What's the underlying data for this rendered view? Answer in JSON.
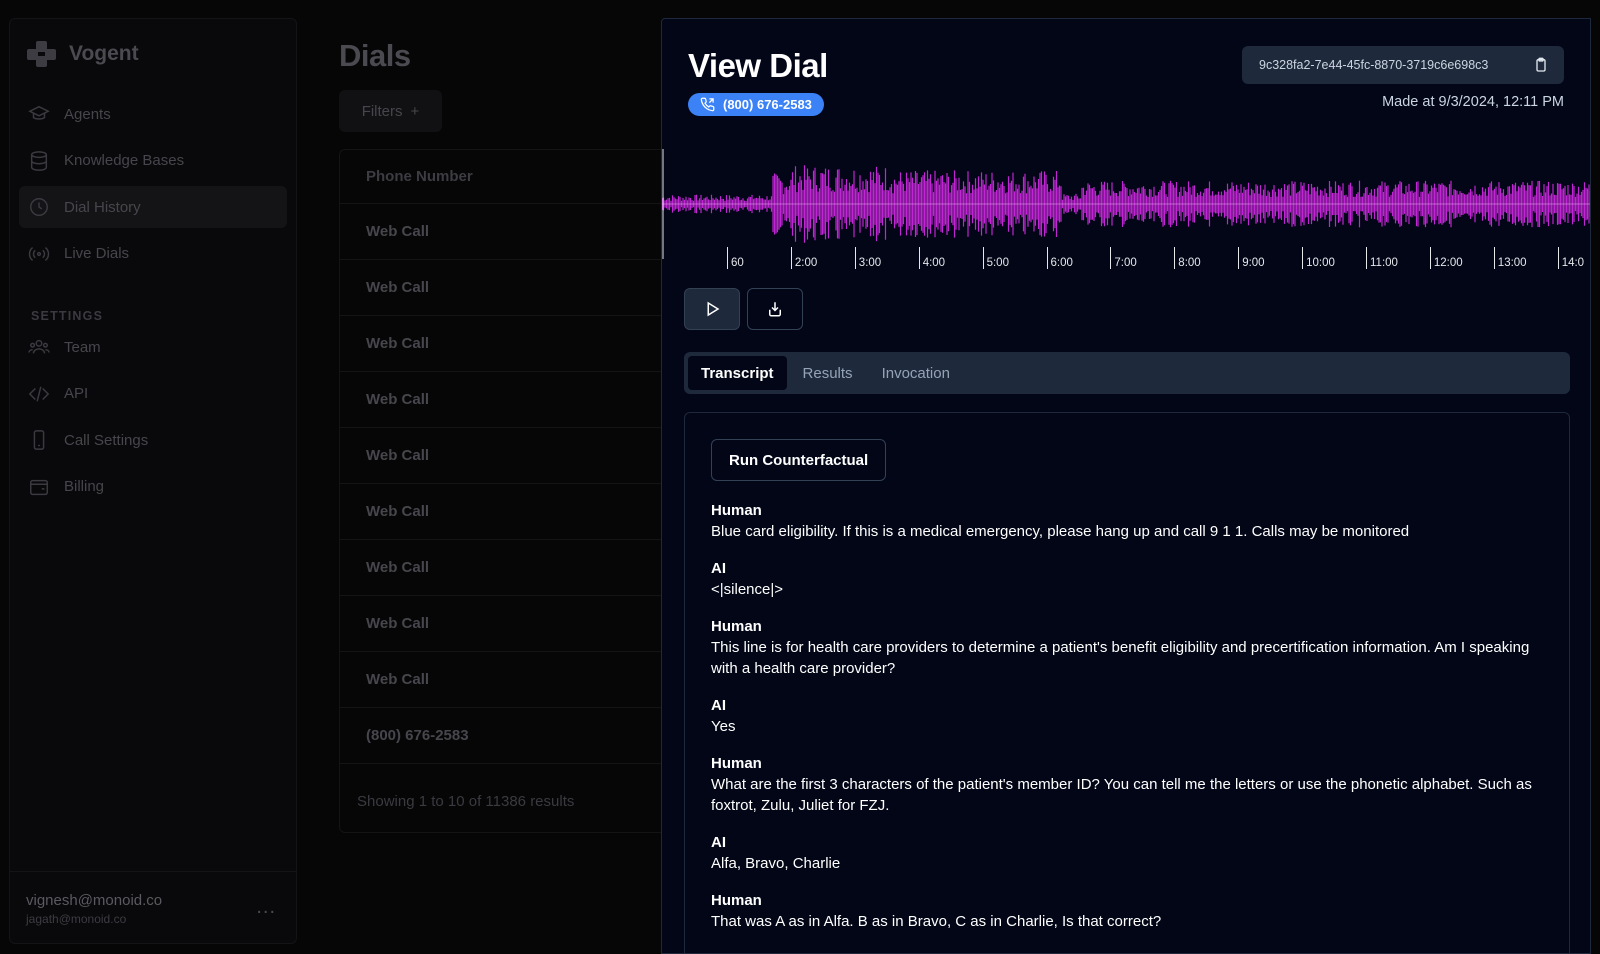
{
  "app": {
    "name": "Vogent",
    "nav": [
      {
        "label": "Agents",
        "icon": "graduation-cap-icon"
      },
      {
        "label": "Knowledge Bases",
        "icon": "database-icon"
      },
      {
        "label": "Dial History",
        "icon": "clock-icon",
        "active": true
      },
      {
        "label": "Live Dials",
        "icon": "broadcast-icon"
      }
    ],
    "settings_heading": "SETTINGS",
    "settings_nav": [
      {
        "label": "Team",
        "icon": "users-icon"
      },
      {
        "label": "API",
        "icon": "code-icon"
      },
      {
        "label": "Call Settings",
        "icon": "phone-device-icon"
      },
      {
        "label": "Billing",
        "icon": "wallet-icon"
      }
    ],
    "user": {
      "email": "vignesh@monoid.co",
      "sub": "jagath@monoid.co",
      "more": "..."
    }
  },
  "dials": {
    "title": "Dials",
    "filters_label": "Filters",
    "column_header": "Phone Number",
    "rows": [
      "Web Call",
      "Web Call",
      "Web Call",
      "Web Call",
      "Web Call",
      "Web Call",
      "Web Call",
      "Web Call",
      "Web Call",
      "(800) 676-2583"
    ],
    "footer": "Showing 1 to 10 of 11386 results"
  },
  "drawer": {
    "title": "View Dial",
    "phone": "(800) 676-2583",
    "dial_id": "9c328fa2-7e44-45fc-8870-3719c6e698c3",
    "made_at": "Made at 9/3/2024, 12:11 PM",
    "timeline_labels": [
      "60",
      "2:00",
      "3:00",
      "4:00",
      "5:00",
      "6:00",
      "7:00",
      "8:00",
      "9:00",
      "10:00",
      "11:00",
      "12:00",
      "13:00",
      "14:0"
    ],
    "waveform_color": "#c026d3",
    "tabs": [
      {
        "label": "Transcript",
        "active": true
      },
      {
        "label": "Results"
      },
      {
        "label": "Invocation"
      }
    ],
    "run_button": "Run Counterfactual",
    "transcript": [
      {
        "speaker": "Human",
        "text": "Blue card eligibility. If this is a medical emergency, please hang up and call 9 1 1. Calls may be monitored"
      },
      {
        "speaker": "AI",
        "text": "<|silence|>"
      },
      {
        "speaker": "Human",
        "text": "This line is for health care providers to determine a patient's benefit eligibility and precertification information. Am I speaking with a health care provider?"
      },
      {
        "speaker": "AI",
        "text": "Yes"
      },
      {
        "speaker": "Human",
        "text": "What are the first 3 characters of the patient's member ID? You can tell me the letters or use the phonetic alphabet. Such as foxtrot, Zulu, Juliet for FZJ."
      },
      {
        "speaker": "AI",
        "text": "Alfa, Bravo, Charlie"
      },
      {
        "speaker": "Human",
        "text": "That was A as in Alfa. B as in Bravo, C as in Charlie, Is that correct?"
      }
    ]
  }
}
